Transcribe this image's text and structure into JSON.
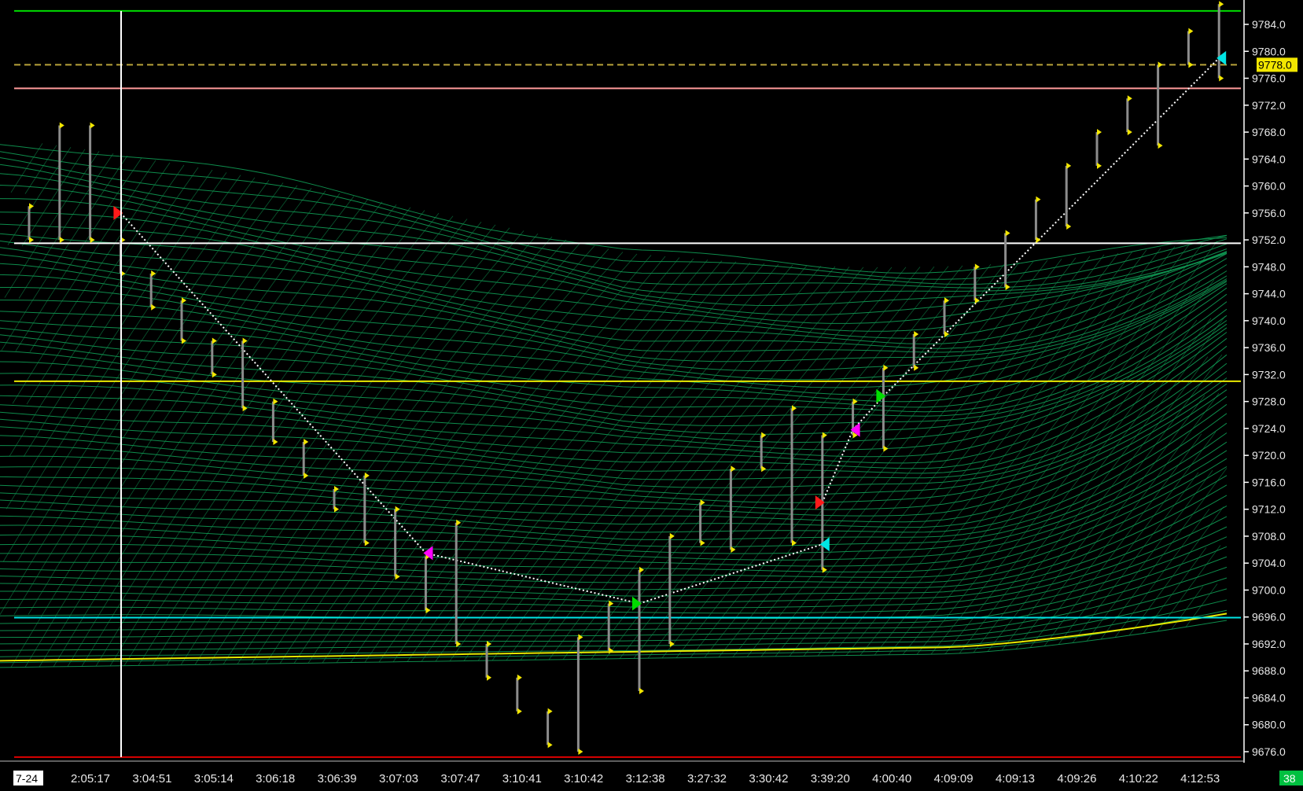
{
  "chart_data": {
    "type": "bar",
    "subtype": "ohlc-range-bars",
    "title": "",
    "xlabel": "",
    "ylabel": "",
    "date_label": "7-24",
    "bar_count_label": "38",
    "current_price_label": "9778.0",
    "ylim": [
      9674,
      9788
    ],
    "y_ticks": [
      9676,
      9680,
      9684,
      9688,
      9692,
      9696,
      9700,
      9704,
      9708,
      9712,
      9716,
      9720,
      9724,
      9728,
      9732,
      9736,
      9740,
      9744,
      9748,
      9752,
      9756,
      9760,
      9764,
      9768,
      9772,
      9776,
      9780,
      9784
    ],
    "y_tick_labels": [
      "9676.0",
      "9680.0",
      "9684.0",
      "9688.0",
      "9692.0",
      "9696.0",
      "9700.0",
      "9704.0",
      "9708.0",
      "9712.0",
      "9716.0",
      "9720.0",
      "9724.0",
      "9728.0",
      "9732.0",
      "9736.0",
      "9740.0",
      "9744.0",
      "9748.0",
      "9752.0",
      "9756.0",
      "9760.0",
      "9764.0",
      "9768.0",
      "9772.0",
      "9776.0",
      "9780.0",
      "9784.0"
    ],
    "x_tick_labels": [
      "2:05:17",
      "3:04:51",
      "3:05:14",
      "3:06:18",
      "3:06:39",
      "3:07:03",
      "3:07:47",
      "3:10:41",
      "3:10:42",
      "3:12:38",
      "3:27:32",
      "3:30:42",
      "3:39:20",
      "4:00:40",
      "4:09:09",
      "4:09:13",
      "4:09:26",
      "4:10:22",
      "4:12:53"
    ],
    "bars": [
      {
        "high": 9757,
        "low": 9752
      },
      {
        "high": 9769,
        "low": 9752
      },
      {
        "high": 9769,
        "low": 9752
      },
      {
        "high": 9752,
        "low": 9747
      },
      {
        "high": 9747,
        "low": 9742
      },
      {
        "high": 9743,
        "low": 9737
      },
      {
        "high": 9737,
        "low": 9732
      },
      {
        "high": 9737,
        "low": 9727
      },
      {
        "high": 9728,
        "low": 9722
      },
      {
        "high": 9722,
        "low": 9717
      },
      {
        "high": 9715,
        "low": 9712
      },
      {
        "high": 9717,
        "low": 9707
      },
      {
        "high": 9712,
        "low": 9702
      },
      {
        "high": 9705,
        "low": 9697
      },
      {
        "high": 9710,
        "low": 9692
      },
      {
        "high": 9692,
        "low": 9687
      },
      {
        "high": 9687,
        "low": 9682
      },
      {
        "high": 9682,
        "low": 9677
      },
      {
        "high": 9693,
        "low": 9676
      },
      {
        "high": 9698,
        "low": 9691
      },
      {
        "high": 9703,
        "low": 9685
      },
      {
        "high": 9708,
        "low": 9692
      },
      {
        "high": 9713,
        "low": 9707
      },
      {
        "high": 9718,
        "low": 9706
      },
      {
        "high": 9723,
        "low": 9718
      },
      {
        "high": 9727,
        "low": 9707
      },
      {
        "high": 9723,
        "low": 9703
      },
      {
        "high": 9728,
        "low": 9723
      },
      {
        "high": 9733,
        "low": 9721
      },
      {
        "high": 9738,
        "low": 9733
      },
      {
        "high": 9743,
        "low": 9738
      },
      {
        "high": 9748,
        "low": 9743
      },
      {
        "high": 9753,
        "low": 9745
      },
      {
        "high": 9758,
        "low": 9752
      },
      {
        "high": 9763,
        "low": 9754
      },
      {
        "high": 9768,
        "low": 9763
      },
      {
        "high": 9773,
        "low": 9768
      },
      {
        "high": 9778,
        "low": 9766
      },
      {
        "high": 9783,
        "low": 9778
      },
      {
        "high": 9787,
        "low": 9776
      }
    ],
    "horizontal_levels": [
      {
        "price": 9786.0,
        "color": "#00dd00",
        "style": "solid"
      },
      {
        "price": 9778.0,
        "color": "#b8a23a",
        "style": "dashed"
      },
      {
        "price": 9774.5,
        "color": "#ff9a9a",
        "style": "solid"
      },
      {
        "price": 9751.5,
        "color": "#ffffff",
        "style": "solid"
      },
      {
        "price": 9731.0,
        "color": "#e8e800",
        "style": "solid"
      },
      {
        "price": 9695.9,
        "color": "#00e5e5",
        "style": "solid"
      },
      {
        "price": 9675.2,
        "color": "#dd0000",
        "style": "solid"
      }
    ],
    "signals": [
      {
        "bar": 3,
        "price": 9756.0,
        "color": "#ff1a1a",
        "dir": "right"
      },
      {
        "bar": 13,
        "price": 9705.5,
        "color": "#ff00ff",
        "dir": "left"
      },
      {
        "bar": 20,
        "price": 9698.0,
        "color": "#00dd00",
        "dir": "right"
      },
      {
        "bar": 26,
        "price": 9713.0,
        "color": "#ff1a1a",
        "dir": "right"
      },
      {
        "bar": 26,
        "price": 9706.8,
        "color": "#00e5e5",
        "dir": "left"
      },
      {
        "bar": 27,
        "price": 9723.8,
        "color": "#ff00ff",
        "dir": "left"
      },
      {
        "bar": 28,
        "price": 9728.8,
        "color": "#00dd00",
        "dir": "right"
      },
      {
        "bar": 39,
        "price": 9779.0,
        "color": "#00e5e5",
        "dir": "left"
      }
    ],
    "colors": {
      "background": "#000000",
      "ribbon": "#0f9450",
      "bar": "#8c8c8c",
      "close_tick": "#f2e600",
      "crosshair": "#ffffff",
      "price_badge": "#f2e600",
      "count_badge": "#00c040"
    }
  }
}
